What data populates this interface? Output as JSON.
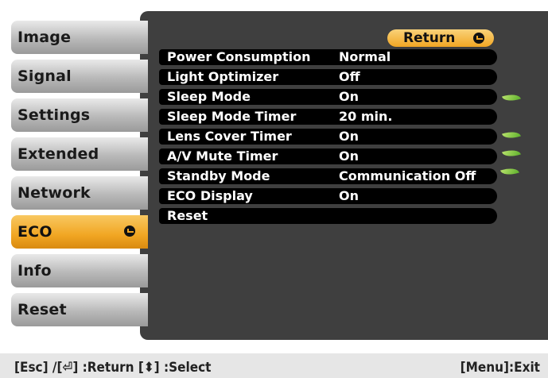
{
  "sidebar": {
    "items": [
      {
        "label": "Image"
      },
      {
        "label": "Signal"
      },
      {
        "label": "Settings"
      },
      {
        "label": "Extended"
      },
      {
        "label": "Network"
      },
      {
        "label": "ECO"
      },
      {
        "label": "Info"
      },
      {
        "label": "Reset"
      }
    ],
    "active_index": 5
  },
  "panel": {
    "return_label": "Return"
  },
  "rows": [
    {
      "label": "Power Consumption",
      "value": "Normal"
    },
    {
      "label": "Light Optimizer",
      "value": "Off"
    },
    {
      "label": "Sleep Mode",
      "value": "On"
    },
    {
      "label": "Sleep Mode Timer",
      "value": "20 min."
    },
    {
      "label": "Lens Cover Timer",
      "value": "On"
    },
    {
      "label": "A/V Mute Timer",
      "value": "On"
    },
    {
      "label": "Standby Mode",
      "value": "Communication Off"
    },
    {
      "label": "ECO Display",
      "value": "On"
    },
    {
      "label": "Reset",
      "value": ""
    }
  ],
  "footer": {
    "hints": "[Esc] /[⏎] :Return  [⬍] :Select",
    "exit": "[Menu]:Exit"
  },
  "colors": {
    "accent": "#f1a623",
    "panel": "#3f3f3f",
    "leaf": "#6abf35"
  }
}
